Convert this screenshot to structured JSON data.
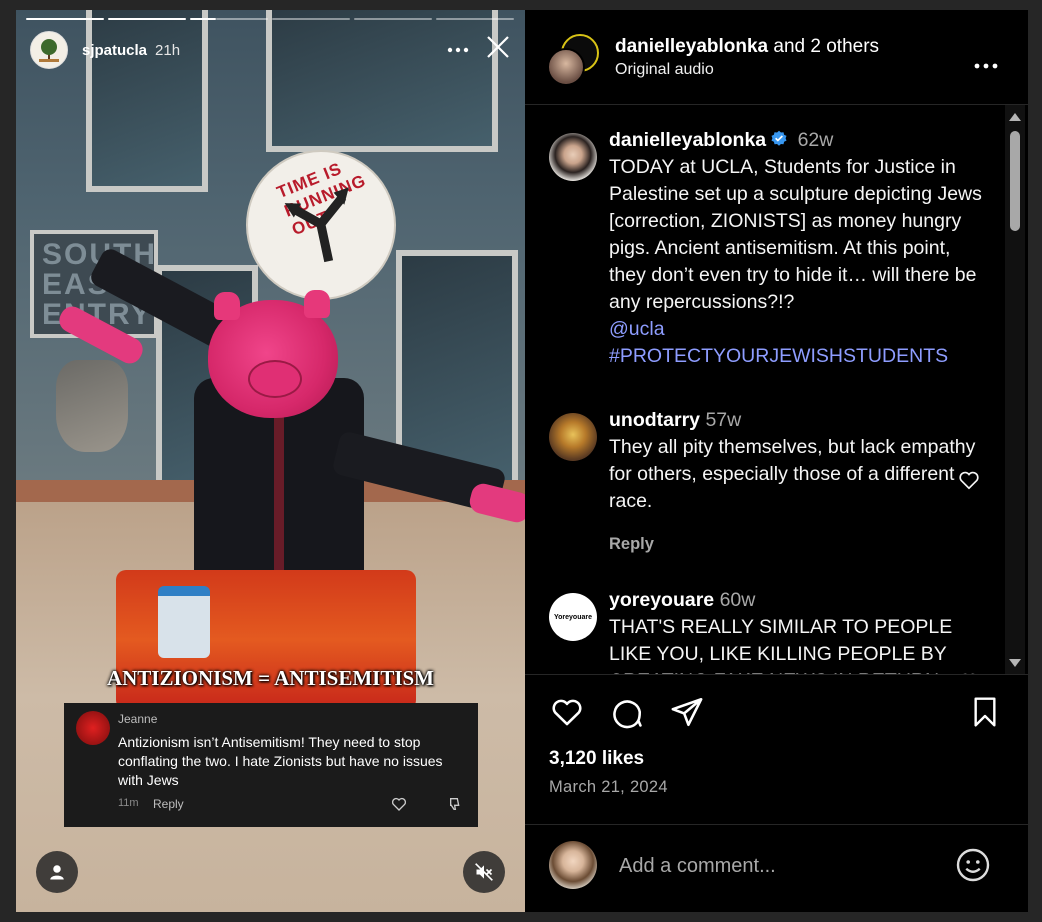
{
  "story": {
    "username": "sjpatucla",
    "time": "21h",
    "overlay_caption": "ANTIZIONISM = ANTISEMITISM",
    "sign_text": "TIME IS RUNNING OUT",
    "wall_text": "SOUTH EAST ENTRY",
    "progress_segments": 6,
    "progress_current": 3,
    "reply_card": {
      "name": "Jeanne",
      "text": "Antizionism isn’t Antisemitism! They need to stop conflating the two. I hate Zionists but have no issues with Jews",
      "time": "11m",
      "reply_label": "Reply"
    }
  },
  "post_header": {
    "username": "danielleyablonka",
    "suffix": " and 2 others",
    "audio": "Original audio"
  },
  "caption": {
    "username": "danielleyablonka",
    "time": "62w",
    "text": "TODAY at UCLA, Students for Justice in Palestine set up a sculpture depicting Jews [correction, ZIONISTS] as money hungry pigs. Ancient antisemitism. At this point, they don’t even try to hide it… will there be any repercussions?!?",
    "mention": "@ucla",
    "hashtag": "#PROTECTYOURJEWISHSTUDENTS"
  },
  "comments": [
    {
      "username": "unodtarry",
      "time": "57w",
      "text": "They all pity themselves, but lack empathy for others, especially those of a different race.",
      "reply_label": "Reply"
    },
    {
      "username": "yoreyouare",
      "avatar_text": "Yoreyouare",
      "time": "60w",
      "text": "THAT'S REALLY SIMILAR TO PEOPLE LIKE YOU, LIKE KILLING PEOPLE BY CREATING FAKE NEWS IN RETURN"
    }
  ],
  "stats": {
    "likes": "3,120 likes",
    "date": "March 21, 2024"
  },
  "add_comment": {
    "placeholder": "Add a comment..."
  },
  "colors": {
    "link": "#8e9dff",
    "muted": "#a8a8a8",
    "verified": "#3897f0"
  }
}
